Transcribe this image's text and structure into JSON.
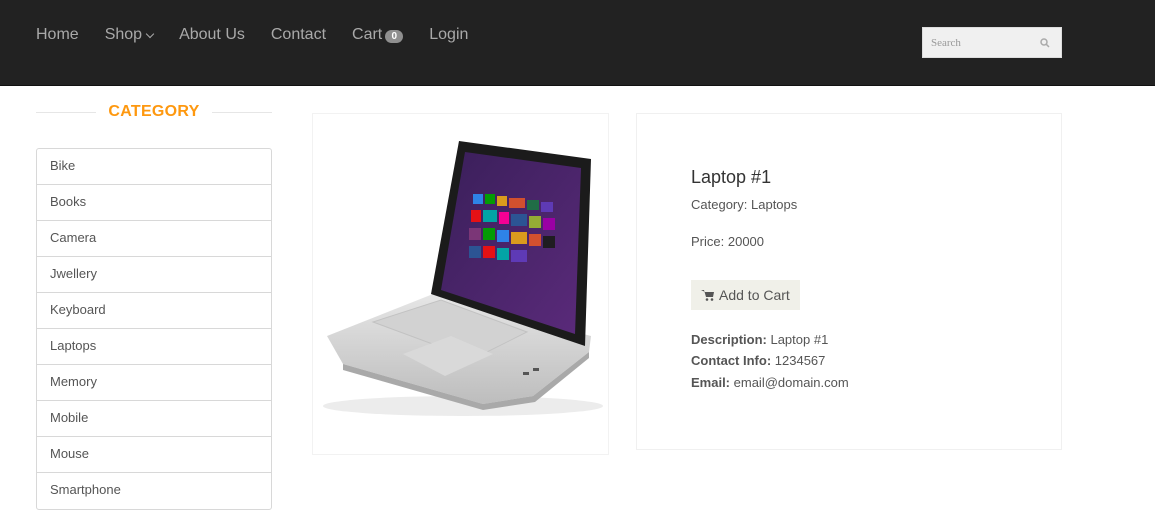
{
  "nav": {
    "home": "Home",
    "shop": "Shop",
    "about": "About Us",
    "contact": "Contact",
    "cart": "Cart",
    "cart_count": "0",
    "login": "Login"
  },
  "search": {
    "placeholder": "Search",
    "icon": "search-icon"
  },
  "sidebar": {
    "heading": "CATEGORY",
    "items": [
      {
        "label": "Bike"
      },
      {
        "label": "Books"
      },
      {
        "label": "Camera"
      },
      {
        "label": "Jwellery"
      },
      {
        "label": "Keyboard"
      },
      {
        "label": "Laptops"
      },
      {
        "label": "Memory"
      },
      {
        "label": "Mobile"
      },
      {
        "label": "Mouse"
      },
      {
        "label": "Smartphone"
      }
    ]
  },
  "product": {
    "name": "Laptop #1",
    "category_label": "Category:",
    "category": "Laptops",
    "price_label": "Price:",
    "price": "20000",
    "add_to_cart": "Add to Cart",
    "description_label": "Description:",
    "description": "Laptop #1",
    "contact_label": "Contact Info:",
    "contact": "1234567",
    "email_label": "Email:",
    "email": "email@domain.com"
  },
  "colors": {
    "header_bg": "#222222",
    "accent": "#fe980f",
    "button_bg": "#f0f0e9"
  }
}
